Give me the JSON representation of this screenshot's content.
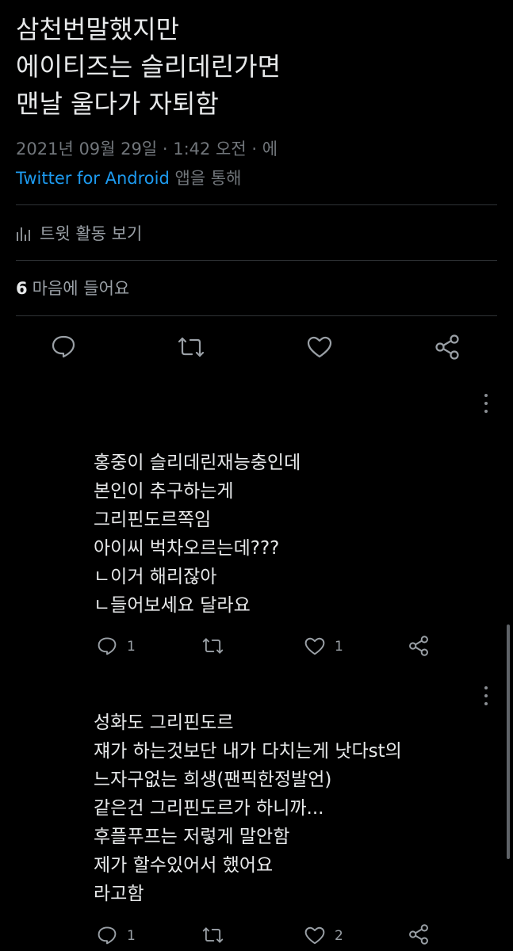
{
  "tweet": {
    "lines": [
      "삼천번말했지만",
      "에이티즈는 슬리데린가면",
      "맨날 울다가 자퇴함"
    ],
    "timestamp": "2021년 09월 29일 · 1:42 오전 · 에",
    "source_app": "Twitter for Android",
    "source_suffix": " 앱을 통해",
    "activity_label": "트윗 활동 보기",
    "likes_count": "6",
    "likes_label": "마음에 들어요"
  },
  "replies": [
    {
      "lines": [
        "홍중이 슬리데린재능충인데",
        "본인이 추구하는게",
        "그리핀도르쪽임",
        "아이씨 벅차오르는데???",
        "ㄴ이거 해리잖아",
        "ㄴ들어보세요 달라요"
      ],
      "reply_count": "1",
      "retweet_count": "",
      "like_count": "1"
    },
    {
      "lines": [
        "성화도 그리핀도르",
        "쟤가 하는것보단 내가 다치는게 낫다st의",
        "느자구없는 희생(팬픽한정발언)",
        "같은건 그리핀도르가 하니까...",
        "후플푸프는 저렇게 말안함",
        "제가 할수있어서 했어요",
        "라고함"
      ],
      "reply_count": "1",
      "retweet_count": "",
      "like_count": "2"
    }
  ],
  "icons": {
    "reply": "reply-bubble-icon",
    "retweet": "retweet-icon",
    "like": "heart-icon",
    "share": "share-icon",
    "more": "more-vertical-icon",
    "activity": "bar-chart-icon"
  },
  "colors": {
    "background": "#000000",
    "text": "#e7e9ea",
    "muted": "#71767b",
    "link": "#1d9bf0",
    "divider": "#2f3336"
  }
}
